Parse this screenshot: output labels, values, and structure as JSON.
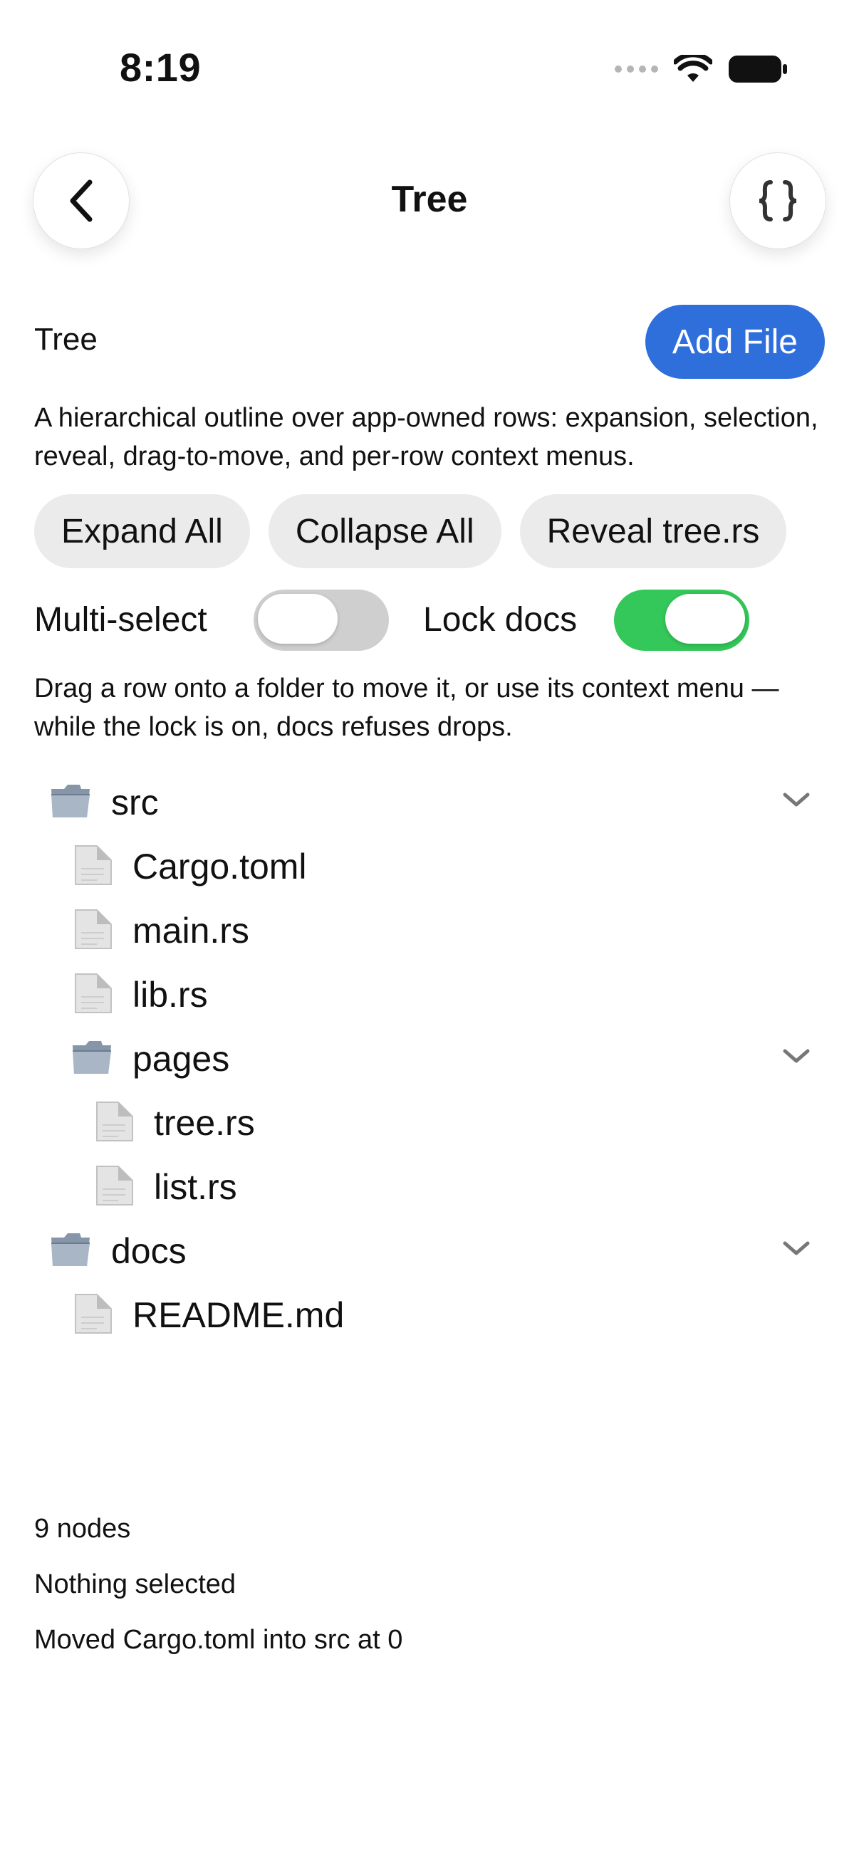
{
  "status_bar": {
    "time": "8:19"
  },
  "nav": {
    "title": "Tree",
    "back_icon": "chevron-left-icon",
    "right_icon": "braces-icon"
  },
  "header": {
    "title": "Tree",
    "add_file_label": "Add File"
  },
  "description": "A hierarchical outline over app-owned rows: expansion, selection, reveal, drag-to-move, and per-row context menus.",
  "actions": [
    {
      "label": "Expand All"
    },
    {
      "label": "Collapse All"
    },
    {
      "label": "Reveal tree.rs"
    }
  ],
  "toggles": {
    "multi_select": {
      "label": "Multi-select",
      "on": false
    },
    "lock_docs": {
      "label": "Lock docs",
      "on": true
    }
  },
  "hint": "Drag a row onto a folder to move it, or use its context menu — while the lock is on, docs refuses drops.",
  "tree": [
    {
      "label": "src",
      "kind": "folder",
      "depth": 0,
      "expanded": true
    },
    {
      "label": "Cargo.toml",
      "kind": "file",
      "depth": 1
    },
    {
      "label": "main.rs",
      "kind": "file",
      "depth": 1
    },
    {
      "label": "lib.rs",
      "kind": "file",
      "depth": 1
    },
    {
      "label": "pages",
      "kind": "folder",
      "depth": 1,
      "expanded": true
    },
    {
      "label": "tree.rs",
      "kind": "file",
      "depth": 2
    },
    {
      "label": "list.rs",
      "kind": "file",
      "depth": 2
    },
    {
      "label": "docs",
      "kind": "folder",
      "depth": 0,
      "expanded": true
    },
    {
      "label": "README.md",
      "kind": "file",
      "depth": 1
    }
  ],
  "footer": {
    "node_count": "9 nodes",
    "selection": "Nothing selected",
    "last_action": "Moved Cargo.toml into src at 0"
  },
  "colors": {
    "accent": "#2f6fdc",
    "toggle_on": "#34c759",
    "toggle_off": "#cfcfcf",
    "pill_bg": "#ebebeb"
  }
}
